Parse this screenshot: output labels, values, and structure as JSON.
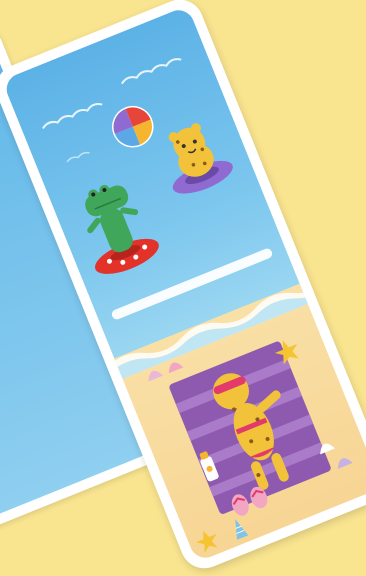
{
  "scene": {
    "description_free": true
  },
  "icons": {
    "crocodile": "crocodile-icon",
    "leopard_swimming": "leopard-icon",
    "leopard_sunbathing": "leopard-sunbathing-icon",
    "beach_ball": "beach-ball-icon",
    "starfish": "starfish-icon",
    "shell": "shell-icon",
    "flip_flops": "flip-flops-icon",
    "sunscreen": "sunscreen-icon",
    "towel": "towel-icon"
  },
  "colors": {
    "background": "#f9e48f",
    "sea": "#5cb2e6",
    "sand": "#f7d594",
    "towel": "#8e5ab0",
    "crocodile": "#3fa65a",
    "leopard": "#f2c23a",
    "float_red": "#e2322a",
    "float_purple": "#8f6ad0"
  }
}
